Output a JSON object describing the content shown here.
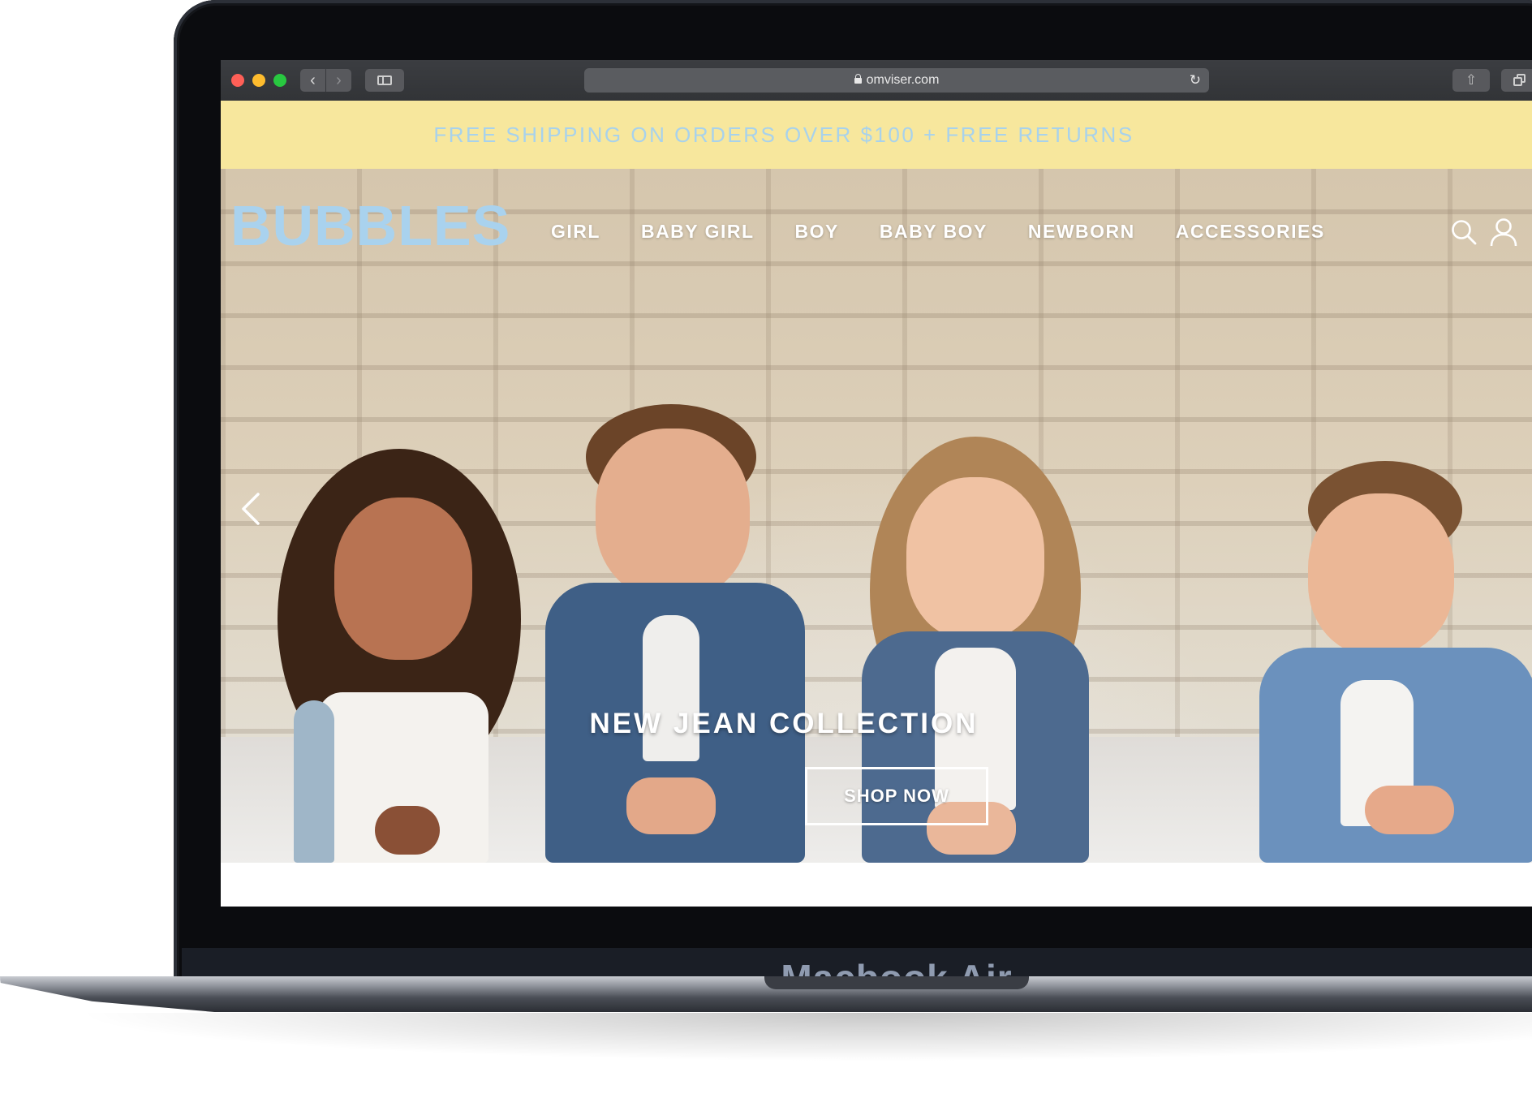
{
  "device": {
    "label": "Macbook Air"
  },
  "browser": {
    "url": "omviser.com",
    "back_icon": "chevron-left-icon",
    "forward_icon": "chevron-right-icon",
    "sidebar_icon": "sidebar-icon",
    "reload_icon": "reload-icon",
    "share_icon": "share-icon",
    "tabs_icon": "tabs-overview-icon"
  },
  "promo_bar": {
    "text": "FREE SHIPPING ON ORDERS OVER $100 + FREE RETURNS",
    "background": "#f7e79d",
    "text_color": "#a8d2ec"
  },
  "header": {
    "logo": "BUBBLES",
    "logo_color": "#a9d2ee",
    "nav": [
      {
        "label": "GIRL"
      },
      {
        "label": "BABY GIRL"
      },
      {
        "label": "BOY"
      },
      {
        "label": "BABY BOY"
      },
      {
        "label": "NEWBORN"
      },
      {
        "label": "ACCESSORIES"
      }
    ],
    "search_icon": "search-icon",
    "account_icon": "user-icon"
  },
  "hero": {
    "title": "NEW JEAN COLLECTION",
    "cta": "SHOP NOW",
    "prev_icon": "chevron-left-icon",
    "image": "four children in denim jackets lying on floor before white brick wall"
  }
}
